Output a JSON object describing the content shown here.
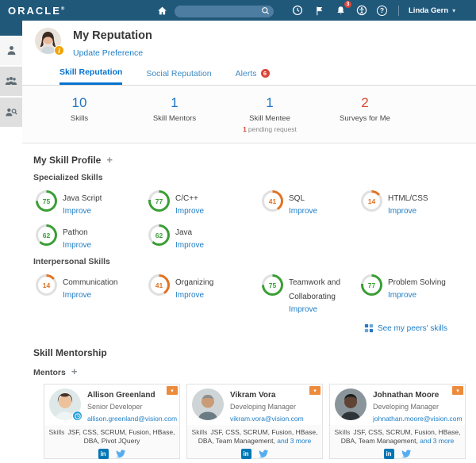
{
  "header": {
    "logo": "ORACLE",
    "user": "Linda Gern",
    "bell_badge": "3",
    "search_value": ""
  },
  "icons": {
    "add": "+",
    "caret_down": "▾",
    "help": "?",
    "linkedin": "in",
    "info": "i"
  },
  "profile": {
    "title": "My Reputation",
    "update_link": "Update Preference"
  },
  "tabs": [
    {
      "label": "Skill Reputation"
    },
    {
      "label": "Social Reputation"
    },
    {
      "label": "Alerts",
      "badge": "6"
    }
  ],
  "stats": [
    {
      "value": "10",
      "label": "Skills"
    },
    {
      "value": "1",
      "label": "Skill Mentors"
    },
    {
      "value": "1",
      "label": "Skill Mentee",
      "sub_count": "1",
      "sub_text": "pending request"
    },
    {
      "value": "2",
      "label": "Surveys for Me"
    }
  ],
  "skill_profile": {
    "title": "My Skill Profile",
    "specialized_title": "Specialized Skills",
    "interpersonal_title": "Interpersonal Skills",
    "improve_label": "Improve",
    "peers_link": "See my peers' skills",
    "specialized": [
      {
        "name": "Java Script",
        "value": 75
      },
      {
        "name": "C/C++",
        "value": 77
      },
      {
        "name": "SQL",
        "value": 41
      },
      {
        "name": "HTML/CSS",
        "value": 14
      },
      {
        "name": "Pathon",
        "value": 62
      },
      {
        "name": "Java",
        "value": 62
      }
    ],
    "interpersonal": [
      {
        "name": "Communication",
        "value": 14
      },
      {
        "name": "Organizing",
        "value": 41
      },
      {
        "name": "Teamwork and Collaborating",
        "value": 75
      },
      {
        "name": "Problem Solving",
        "value": 77
      }
    ]
  },
  "mentorship": {
    "title": "Skill Mentorship",
    "mentors_label": "Mentors",
    "skills_label": "Skills",
    "cards": [
      {
        "name": "Allison Greenland",
        "role": "Senior Developer",
        "email": "allison.greenland@vision.com",
        "skills": "JSF, CSS, SCRUM, Fusion, HBase, DBA, Pivot JQuery",
        "more": ""
      },
      {
        "name": "Vikram Vora",
        "role": "Developing Manager",
        "email": "vikram.vora@vision.com",
        "skills": "JSF, CSS, SCRUM, Fusion, HBase, DBA, Team Management,",
        "more": "and 3 more"
      },
      {
        "name": "Johnathan Moore",
        "role": "Developing Manager",
        "email": "johnathan.moore@vision.com",
        "skills": "JSF, CSS, SCRUM, Fusion, HBase, DBA, Team Management,",
        "more": "and 3 more"
      }
    ]
  },
  "colors": {
    "header_bg": "#20587a",
    "link_blue": "#1f7ec6",
    "active_blue": "#0572ce",
    "green": "#3a9e35",
    "orange": "#e17321",
    "red": "#d6492f",
    "badge_red": "#db4437",
    "dropdown_orange": "#ed8b3c",
    "ring_track": "#e0e0e0"
  }
}
